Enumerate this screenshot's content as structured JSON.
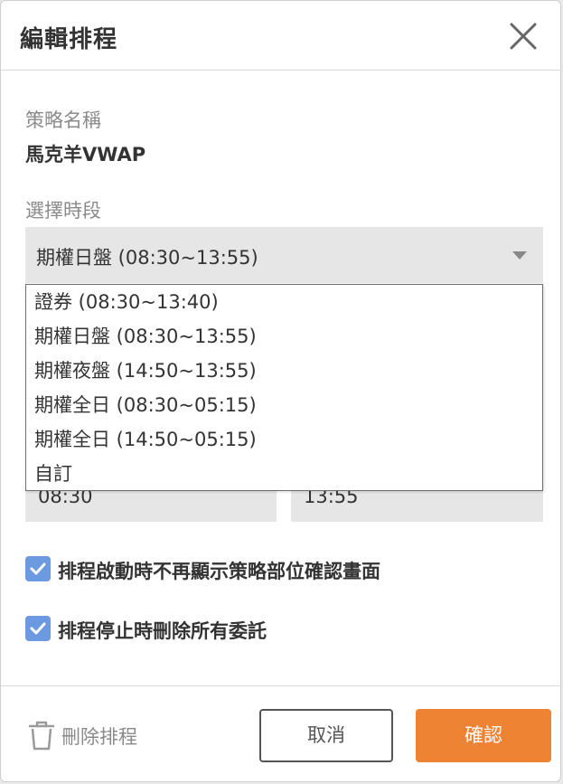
{
  "dialog": {
    "title": "編輯排程"
  },
  "strategy": {
    "label": "策略名稱",
    "value": "馬克羊VWAP"
  },
  "session": {
    "label": "選擇時段",
    "selected": "期權日盤 (08:30~13:55)",
    "options": [
      "證券 (08:30~13:40)",
      "期權日盤 (08:30~13:55)",
      "期權夜盤 (14:50~13:55)",
      "期權全日 (08:30~05:15)",
      "期權全日 (14:50~05:15)",
      "自訂"
    ]
  },
  "time": {
    "start": "08:30",
    "end": "13:55"
  },
  "options": {
    "skip_confirm": {
      "label": "排程啟動時不再顯示策略部位確認畫面",
      "checked": true
    },
    "delete_orders": {
      "label": "排程停止時刪除所有委託",
      "checked": true
    }
  },
  "footer": {
    "delete_label": "刪除排程",
    "cancel_label": "取消",
    "confirm_label": "確認"
  },
  "colors": {
    "accent": "#ef8334",
    "checkbox": "#6c9ae0"
  }
}
